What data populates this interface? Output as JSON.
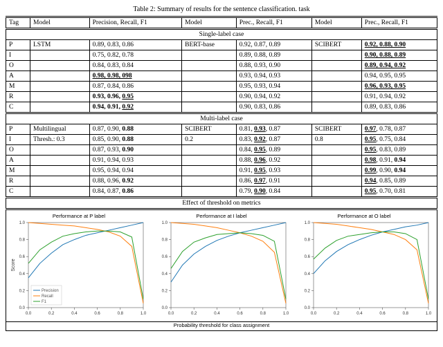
{
  "caption": "Table 2: Summary of results for the sentence classification. task",
  "headers": {
    "tag": "Tag",
    "model": "Model",
    "prf_long": "Precision, Recall, F1",
    "prf_short": "Prec., Recall, F1"
  },
  "sections": {
    "single": "Single-label case",
    "multi": "Multi-label case",
    "threshold": "Effect of threshold on metrics"
  },
  "single": {
    "models": [
      "LSTM",
      "BERT-base",
      "SCIBERT"
    ],
    "rows": [
      {
        "tag": "P",
        "c0": [
          {
            "t": "0.89, 0.83, 0.86"
          }
        ],
        "c1": [
          {
            "t": "0.92, 0.87, 0.89"
          }
        ],
        "c2": [
          {
            "t": "0.92, 0.88, 0.90",
            "b": 1,
            "u": 1
          }
        ]
      },
      {
        "tag": "I",
        "c0": [
          {
            "t": "0.75, 0.82, 0.78"
          }
        ],
        "c1": [
          {
            "t": "0.89, 0.88, 0.89"
          }
        ],
        "c2": [
          {
            "t": "0.90, 0.88, 0.89",
            "b": 1,
            "u": 1
          }
        ]
      },
      {
        "tag": "O",
        "c0": [
          {
            "t": "0.84, 0.83, 0.84"
          }
        ],
        "c1": [
          {
            "t": "0.88, 0.93, 0.90"
          }
        ],
        "c2": [
          {
            "t": "0.89, 0.94, 0.92",
            "b": 1,
            "u": 1
          }
        ]
      },
      {
        "tag": "A",
        "c0": [
          {
            "t": "0.98, 0.98, 098",
            "b": 1,
            "u": 1
          }
        ],
        "c1": [
          {
            "t": "0.93, 0.94, 0.93"
          }
        ],
        "c2": [
          {
            "t": "0.94, 0.95, 0.95"
          }
        ]
      },
      {
        "tag": "M",
        "c0": [
          {
            "t": "0.87, 0.84, 0.86"
          }
        ],
        "c1": [
          {
            "t": "0.95, 0.93, 0.94"
          }
        ],
        "c2": [
          {
            "t": "0.96, 0.93, 0.95",
            "b": 1,
            "u": 1
          }
        ]
      },
      {
        "tag": "R",
        "c0": [
          {
            "t": "0.93"
          },
          {
            "t": ", "
          },
          {
            "t": "0.96"
          },
          {
            "t": ", "
          },
          {
            "t": "0.95",
            "u": 1
          }
        ],
        "bold0": 1,
        "c1": [
          {
            "t": "0.90, 0.94, 0.92"
          }
        ],
        "c2": [
          {
            "t": "0.91, 0.94, 0.92"
          }
        ]
      },
      {
        "tag": "C",
        "c0": [
          {
            "t": "0.94"
          },
          {
            "t": ", "
          },
          {
            "t": "0.91"
          },
          {
            "t": ", "
          },
          {
            "t": "0.92",
            "u": 1
          }
        ],
        "bold0": 1,
        "c1": [
          {
            "t": "0.90, 0.83, 0.86"
          }
        ],
        "c2": [
          {
            "t": "0.89, 0.83, 0.86"
          }
        ]
      }
    ]
  },
  "multi": {
    "model0": "Multilingual",
    "model0note": "Thresh.: 0.3",
    "model1": "SCIBERT",
    "model1note": "0.2",
    "model2": "SCIBERT",
    "model2note": "0.8",
    "rows": [
      {
        "tag": "P",
        "c0": [
          {
            "t": "0.87, 0.90, "
          },
          {
            "t": "0.88",
            "b": 1
          }
        ],
        "c1": [
          {
            "t": "0.81, "
          },
          {
            "t": "0.93",
            "b": 1,
            "u": 1
          },
          {
            "t": ", 0.87"
          }
        ],
        "c2": [
          {
            "t": "0.97",
            "b": 1,
            "u": 1
          },
          {
            "t": ", 0.78, 0.87"
          }
        ]
      },
      {
        "tag": "I",
        "c0": [
          {
            "t": "0.85, 0.90, "
          },
          {
            "t": "0.88",
            "b": 1
          }
        ],
        "c1": [
          {
            "t": "0.83, "
          },
          {
            "t": "0.92",
            "b": 1,
            "u": 1
          },
          {
            "t": ", 0.87"
          }
        ],
        "c2": [
          {
            "t": "0.95",
            "b": 1,
            "u": 1
          },
          {
            "t": ", 0.75, 0.84"
          }
        ]
      },
      {
        "tag": "O",
        "c0": [
          {
            "t": "0.87, 0.93, "
          },
          {
            "t": "0.90",
            "b": 1
          }
        ],
        "c1": [
          {
            "t": "0.84, "
          },
          {
            "t": "0.95",
            "b": 1,
            "u": 1
          },
          {
            "t": ", 0.89"
          }
        ],
        "c2": [
          {
            "t": "0.95",
            "b": 1,
            "u": 1
          },
          {
            "t": ", 0.83, 0.89"
          }
        ]
      },
      {
        "tag": "A",
        "c0": [
          {
            "t": "0.91, 0.94, 0.93"
          }
        ],
        "c1": [
          {
            "t": "0.88, "
          },
          {
            "t": "0.96",
            "b": 1,
            "u": 1
          },
          {
            "t": ", 0.92"
          }
        ],
        "c2": [
          {
            "t": "0.98",
            "b": 1,
            "u": 1
          },
          {
            "t": ", 0.91, "
          },
          {
            "t": "0.94",
            "b": 1
          }
        ]
      },
      {
        "tag": "M",
        "c0": [
          {
            "t": "0.95, 0.94, 0.94"
          }
        ],
        "c1": [
          {
            "t": "0.91, "
          },
          {
            "t": "0.95",
            "b": 1,
            "u": 1
          },
          {
            "t": ", 0.93"
          }
        ],
        "c2": [
          {
            "t": "0.99",
            "b": 1,
            "u": 1
          },
          {
            "t": ", 0.90, "
          },
          {
            "t": "0.94",
            "b": 1
          }
        ]
      },
      {
        "tag": "R",
        "c0": [
          {
            "t": "0.88, 0.96, "
          },
          {
            "t": "0.92",
            "b": 1
          }
        ],
        "c1": [
          {
            "t": "0.86, "
          },
          {
            "t": "0.97",
            "b": 1,
            "u": 1
          },
          {
            "t": ", 0.91"
          }
        ],
        "c2": [
          {
            "t": "0.94",
            "b": 1,
            "u": 1
          },
          {
            "t": ", 0.85, 0.89"
          }
        ]
      },
      {
        "tag": "C",
        "c0": [
          {
            "t": "0.84, 0.87, "
          },
          {
            "t": "0.86",
            "b": 1
          }
        ],
        "c1": [
          {
            "t": "0.79, "
          },
          {
            "t": "0.90",
            "b": 1,
            "u": 1
          },
          {
            "t": ", 0.84"
          }
        ],
        "c2": [
          {
            "t": "0.95",
            "b": 1,
            "u": 1
          },
          {
            "t": ", 0.70, 0.81"
          }
        ]
      }
    ]
  },
  "chart_data": [
    {
      "type": "line",
      "title": "Performance at P label",
      "xlabel": "Probability threshold for class assignment",
      "ylabel": "Score",
      "xlim": [
        0,
        1
      ],
      "ylim": [
        0,
        1
      ],
      "legend": [
        "Precision",
        "Recall",
        "F1"
      ],
      "series": [
        {
          "name": "Precision",
          "values": [
            0.35,
            0.52,
            0.64,
            0.74,
            0.8,
            0.85,
            0.88,
            0.91,
            0.94,
            0.97,
            1.0
          ]
        },
        {
          "name": "Recall",
          "values": [
            1.0,
            0.99,
            0.98,
            0.97,
            0.96,
            0.94,
            0.92,
            0.89,
            0.84,
            0.72,
            0.05
          ]
        },
        {
          "name": "F1",
          "values": [
            0.52,
            0.68,
            0.77,
            0.84,
            0.87,
            0.89,
            0.9,
            0.9,
            0.89,
            0.83,
            0.1
          ]
        }
      ],
      "x": [
        0.0,
        0.1,
        0.2,
        0.3,
        0.4,
        0.5,
        0.6,
        0.7,
        0.8,
        0.9,
        1.0
      ]
    },
    {
      "type": "line",
      "title": "Performance at I label",
      "xlabel": "Probability threshold for class assignment",
      "ylabel": "",
      "xlim": [
        0,
        1
      ],
      "ylim": [
        0,
        1
      ],
      "series": [
        {
          "name": "Precision",
          "values": [
            0.3,
            0.5,
            0.63,
            0.72,
            0.79,
            0.84,
            0.88,
            0.91,
            0.94,
            0.97,
            1.0
          ]
        },
        {
          "name": "Recall",
          "values": [
            1.0,
            0.99,
            0.98,
            0.96,
            0.94,
            0.91,
            0.88,
            0.84,
            0.78,
            0.65,
            0.05
          ]
        },
        {
          "name": "F1",
          "values": [
            0.46,
            0.66,
            0.77,
            0.82,
            0.86,
            0.87,
            0.88,
            0.87,
            0.85,
            0.78,
            0.1
          ]
        }
      ],
      "x": [
        0.0,
        0.1,
        0.2,
        0.3,
        0.4,
        0.5,
        0.6,
        0.7,
        0.8,
        0.9,
        1.0
      ]
    },
    {
      "type": "line",
      "title": "Performance at O label",
      "xlabel": "Probability threshold for class assignment",
      "ylabel": "",
      "xlim": [
        0,
        1
      ],
      "ylim": [
        0,
        1
      ],
      "series": [
        {
          "name": "Precision",
          "values": [
            0.4,
            0.55,
            0.66,
            0.74,
            0.8,
            0.85,
            0.89,
            0.92,
            0.95,
            0.97,
            1.0
          ]
        },
        {
          "name": "Recall",
          "values": [
            1.0,
            0.99,
            0.98,
            0.96,
            0.94,
            0.92,
            0.89,
            0.86,
            0.8,
            0.68,
            0.05
          ]
        },
        {
          "name": "F1",
          "values": [
            0.57,
            0.7,
            0.79,
            0.84,
            0.86,
            0.88,
            0.89,
            0.89,
            0.87,
            0.8,
            0.1
          ]
        }
      ],
      "x": [
        0.0,
        0.1,
        0.2,
        0.3,
        0.4,
        0.5,
        0.6,
        0.7,
        0.8,
        0.9,
        1.0
      ]
    }
  ],
  "legend_labels": {
    "precision": "Precision",
    "recall": "Recall",
    "f1": "F1"
  }
}
